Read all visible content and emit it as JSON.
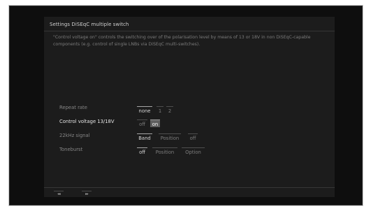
{
  "dialog": {
    "title": "Settings DiSEqC multiple switch",
    "description": "\"Control voltage on\" controls the switching over of the polarisation level by means of 13 or 18V in non DiSEqC-capable components (e.g. control of single LNBs via DiSEqC multi-switches)."
  },
  "rows": {
    "repeat_rate": {
      "label": "Repeat rate",
      "options": [
        "none",
        "1",
        "2"
      ],
      "selected": "none"
    },
    "control_voltage": {
      "label": "Control voltage 13/18V",
      "options": [
        "off",
        "on"
      ],
      "selected": "on"
    },
    "signal_22khz": {
      "label": "22kHz signal",
      "options": [
        "Band",
        "Position",
        "off"
      ],
      "selected": "Band"
    },
    "toneburst": {
      "label": "Toneburst",
      "options": [
        "off",
        "Position",
        "Option"
      ],
      "selected": "off"
    }
  },
  "nav": {
    "rewind": "◂◂",
    "forward": "▸▸"
  },
  "colors": {
    "background": "#1c1c1c",
    "highlight": "#5e5e5e",
    "text_active": "#e6e6e6",
    "text_muted": "#868686"
  }
}
